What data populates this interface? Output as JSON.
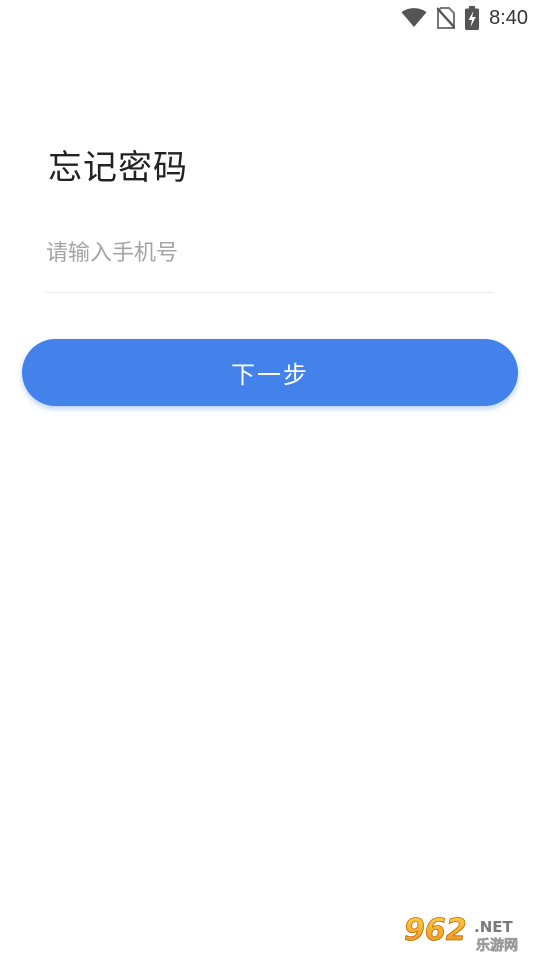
{
  "status_bar": {
    "time": "8:40",
    "icons": [
      "wifi-icon",
      "no-sim-icon",
      "battery-charging-icon"
    ]
  },
  "page": {
    "title": "忘记密码"
  },
  "form": {
    "phone_placeholder": "请输入手机号",
    "phone_value": "",
    "next_label": "下一步"
  },
  "colors": {
    "primary": "#4382ea",
    "placeholder": "#a4a4a4",
    "divider": "#ececec",
    "title": "#222222"
  },
  "watermark": {
    "number": "962",
    "suffix": ".NET",
    "subtitle": "乐游网"
  }
}
